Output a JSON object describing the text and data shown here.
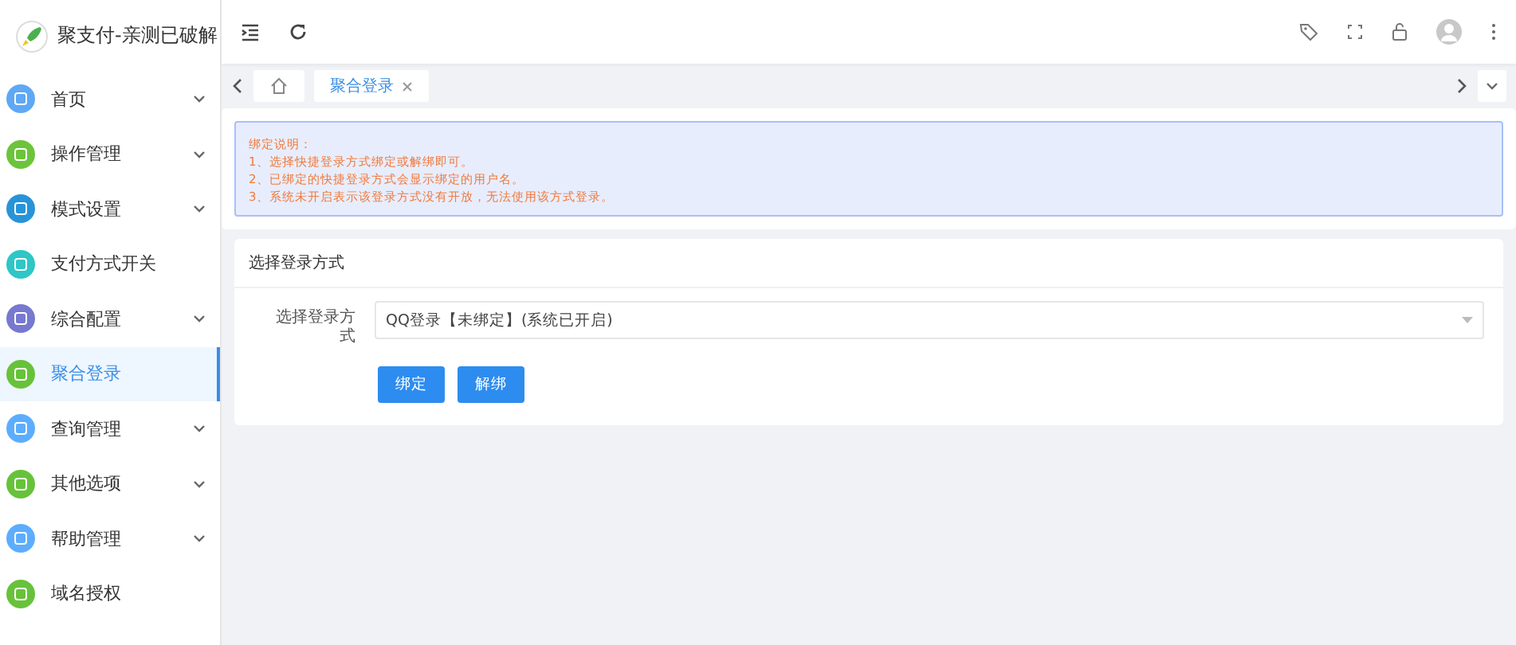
{
  "sidebar": {
    "title": "聚支付-亲测已破解",
    "items": [
      {
        "label": "首页",
        "color": "#5ea8f6",
        "expandable": true,
        "selected": false
      },
      {
        "label": "操作管理",
        "color": "#6cc43a",
        "expandable": true,
        "selected": false
      },
      {
        "label": "模式设置",
        "color": "#2794d8",
        "expandable": true,
        "selected": false
      },
      {
        "label": "支付方式开关",
        "color": "#2ec6c6",
        "expandable": false,
        "selected": false
      },
      {
        "label": "综合配置",
        "color": "#7778d0",
        "expandable": true,
        "selected": false
      },
      {
        "label": "聚合登录",
        "color": "#67c23a",
        "expandable": false,
        "selected": true
      },
      {
        "label": "查询管理",
        "color": "#5cadff",
        "expandable": true,
        "selected": false
      },
      {
        "label": "其他选项",
        "color": "#67c23a",
        "expandable": true,
        "selected": false
      },
      {
        "label": "帮助管理",
        "color": "#5cadff",
        "expandable": true,
        "selected": false
      },
      {
        "label": "域名授权",
        "color": "#67c23a",
        "expandable": false,
        "selected": false
      }
    ]
  },
  "tabs": [
    {
      "kind": "home",
      "selected": false,
      "closable": false
    },
    {
      "kind": "page",
      "label": "聚合登录",
      "selected": true,
      "closable": true
    }
  ],
  "notice": {
    "title": "绑定说明：",
    "lines": [
      "1、选择快捷登录方式绑定或解绑即可。",
      "2、已绑定的快捷登录方式会显示绑定的用户名。",
      "3、系统未开启表示该登录方式没有开放，无法使用该方式登录。"
    ]
  },
  "form": {
    "title": "选择登录方式",
    "field_label": "选择登录方式",
    "select_value": "QQ登录【未绑定】(系统已开启)",
    "buttons": [
      "绑定",
      "解绑"
    ]
  }
}
